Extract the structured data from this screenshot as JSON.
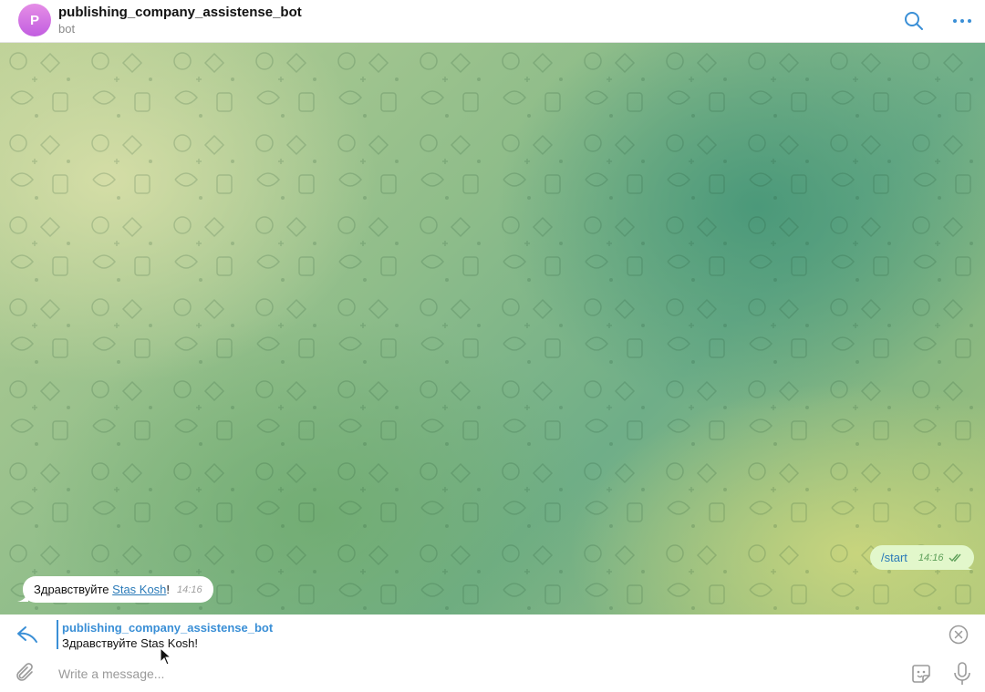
{
  "header": {
    "avatar_letter": "P",
    "title": "publishing_company_assistense_bot",
    "subtitle": "bot",
    "search_icon": "search-icon",
    "more_icon": "more-dots-icon"
  },
  "messages": {
    "outgoing": {
      "text": "/start",
      "time": "14:16",
      "status_icon": "double-check-icon"
    },
    "incoming": {
      "prefix": "Здравствуйте ",
      "link_text": "Stas Kosh",
      "suffix": "!",
      "time": "14:16"
    }
  },
  "reply": {
    "icon": "reply-arrow-icon",
    "name": "publishing_company_assistense_bot",
    "text": "Здравствуйте Stas Kosh!",
    "close_icon": "close-circle-icon"
  },
  "composer": {
    "placeholder": "Write a message...",
    "value": "",
    "attach_icon": "paperclip-icon",
    "sticker_icon": "sticker-icon",
    "mic_icon": "microphone-icon"
  },
  "colors": {
    "accent": "#3a8fd6",
    "outgoing_bubble": "#e2f7cb",
    "link": "#2a7ab8",
    "avatar_gradient_top": "#e58ee6",
    "avatar_gradient_bottom": "#c25ee0"
  }
}
